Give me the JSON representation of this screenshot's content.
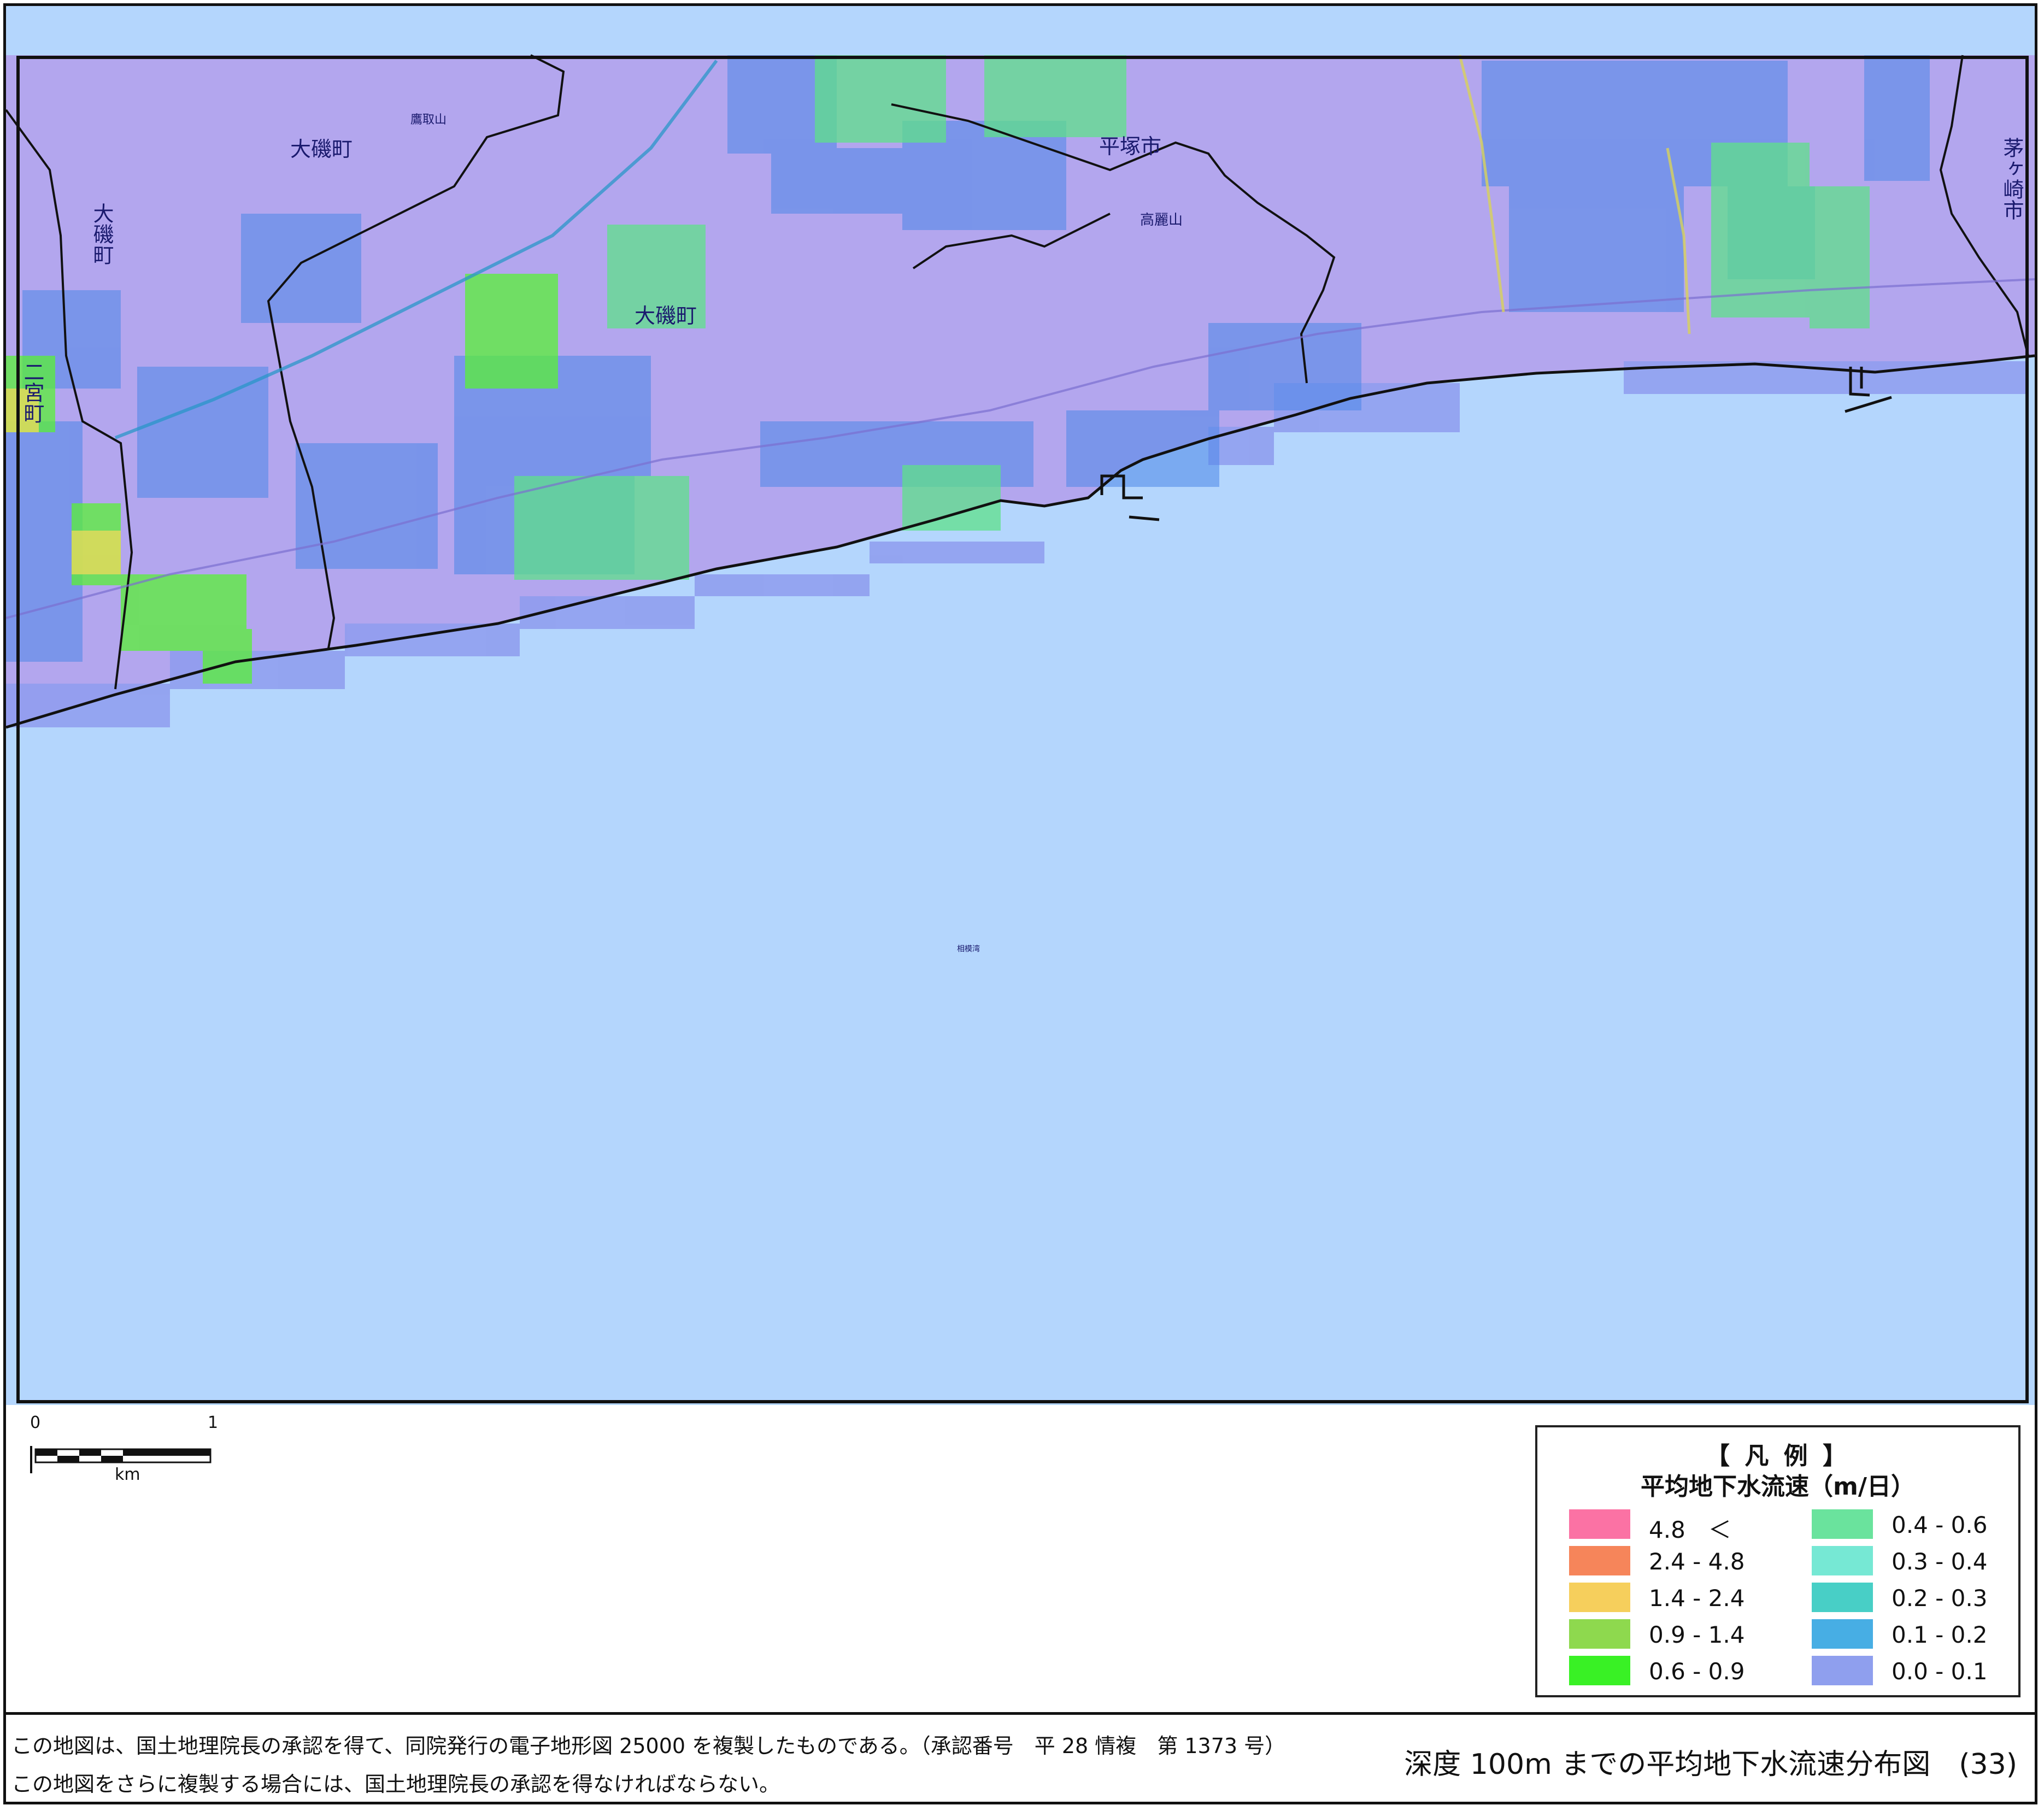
{
  "map": {
    "place_labels": [
      "大磯町",
      "大磯町",
      "大磯町",
      "平塚市",
      "茅ヶ崎市",
      "二宮町",
      "鷹取山",
      "高麗山",
      "相模湾"
    ],
    "colors": {
      "land": "#b3a6ee",
      "sea": "#b4d6fd",
      "coast_band": "#8e9cee"
    }
  },
  "scale": {
    "zero": "0",
    "one": "1",
    "unit": "km"
  },
  "legend": {
    "title": "【 凡 例 】",
    "subtitle": "平均地下水流速（m/日）",
    "items": [
      {
        "label": "4.8　＜",
        "color": "#fb72a4"
      },
      {
        "label": "2.4 - 4.8",
        "color": "#f6855a"
      },
      {
        "label": "1.4 - 2.4",
        "color": "#f6cf5c"
      },
      {
        "label": "0.9 - 1.4",
        "color": "#8ed94e"
      },
      {
        "label": "0.6 - 0.9",
        "color": "#39f125"
      },
      {
        "label": "0.4 - 0.6",
        "color": "#6ae39d"
      },
      {
        "label": "0.3 - 0.4",
        "color": "#76e8d4"
      },
      {
        "label": "0.2 - 0.3",
        "color": "#48cfc6"
      },
      {
        "label": "0.1 - 0.2",
        "color": "#47aee4"
      },
      {
        "label": "0.0 - 0.1",
        "color": "#8f9fee"
      }
    ]
  },
  "footer": {
    "copyright_1": "この地図は、国土地理院長の承認を得て、同院発行の電子地形図 25000 を複製したものである。（承認番号　平 28 情複　第 1373 号）",
    "copyright_2": "この地図をさらに複製する場合には、国土地理院長の承認を得なければならない。",
    "map_title": "深度 100m までの平均地下水流速分布図　(33)"
  }
}
